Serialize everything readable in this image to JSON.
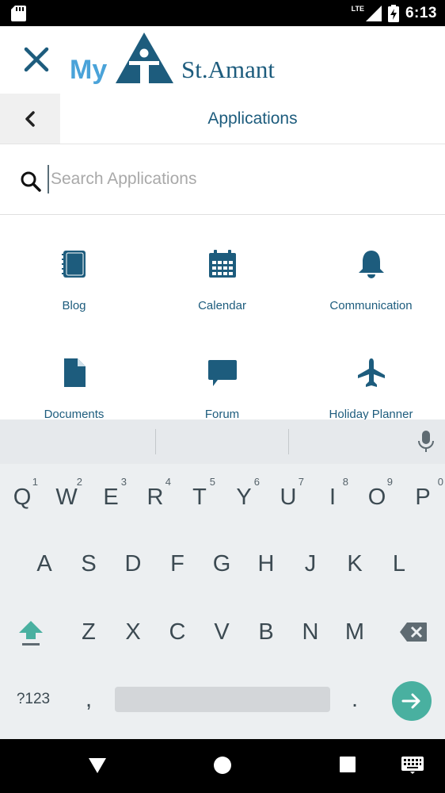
{
  "status_bar": {
    "network": "LTE",
    "time": "6:13"
  },
  "header": {
    "logo_text_left": "My",
    "logo_text_right": "St.Amant"
  },
  "subheader": {
    "title": "Applications"
  },
  "search": {
    "placeholder": "Search Applications",
    "value": ""
  },
  "apps": [
    {
      "label": "Blog",
      "icon": "notebook-icon"
    },
    {
      "label": "Calendar",
      "icon": "calendar-icon"
    },
    {
      "label": "Communication",
      "icon": "bell-icon"
    },
    {
      "label": "Documents",
      "icon": "document-icon"
    },
    {
      "label": "Forum",
      "icon": "chat-bubble-icon"
    },
    {
      "label": "Holiday Planner",
      "icon": "airplane-icon"
    }
  ],
  "keyboard": {
    "row1": [
      {
        "key": "Q",
        "hint": "1"
      },
      {
        "key": "W",
        "hint": "2"
      },
      {
        "key": "E",
        "hint": "3"
      },
      {
        "key": "R",
        "hint": "4"
      },
      {
        "key": "T",
        "hint": "5"
      },
      {
        "key": "Y",
        "hint": "6"
      },
      {
        "key": "U",
        "hint": "7"
      },
      {
        "key": "I",
        "hint": "8"
      },
      {
        "key": "O",
        "hint": "9"
      },
      {
        "key": "P",
        "hint": "0"
      }
    ],
    "row2": [
      "A",
      "S",
      "D",
      "F",
      "G",
      "H",
      "J",
      "K",
      "L"
    ],
    "row3": [
      "Z",
      "X",
      "C",
      "V",
      "B",
      "N",
      "M"
    ],
    "symbols_label": "?123",
    "comma": ",",
    "period": "."
  },
  "colors": {
    "brand_blue": "#1d5c7d",
    "logo_light_blue": "#4aa3d9",
    "accent_teal": "#49b0a0"
  }
}
